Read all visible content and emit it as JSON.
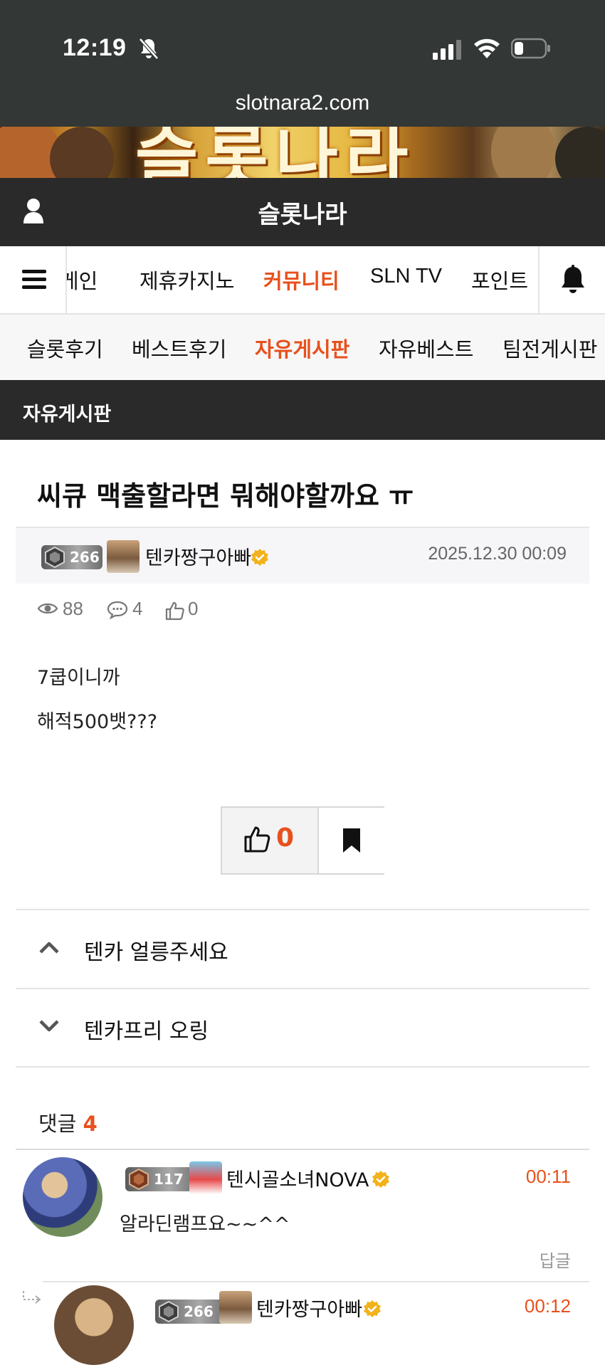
{
  "status_bar": {
    "time": "12:19",
    "url": "slotnara2.com"
  },
  "banner": {
    "text": "슬롯나라"
  },
  "header": {
    "title": "슬롯나라"
  },
  "main_nav": {
    "items": [
      {
        "label": "게인",
        "active": false
      },
      {
        "label": "제휴카지노",
        "active": false
      },
      {
        "label": "커뮤니티",
        "active": true
      },
      {
        "label": "SLN TV",
        "active": false
      },
      {
        "label": "포인트",
        "active": false
      }
    ]
  },
  "sub_nav": {
    "items": [
      {
        "label": "슬롯후기",
        "active": false
      },
      {
        "label": "베스트후기",
        "active": false
      },
      {
        "label": "자유게시판",
        "active": true
      },
      {
        "label": "자유베스트",
        "active": false
      },
      {
        "label": "팀전게시판",
        "active": false
      }
    ]
  },
  "section": {
    "title": "자유게시판"
  },
  "post": {
    "title": "씨큐 맥출할라면 뭐해야할까요 ㅠ",
    "author": {
      "name": "텐카짱구아빠",
      "level": "266"
    },
    "date": "2025.12.30 00:09",
    "views": "88",
    "comments": "4",
    "likes": "0",
    "body": [
      "7쿱이니까",
      "해적500뱃???"
    ],
    "like_count": "0"
  },
  "adjacent": {
    "prev": "텐카 얼릉주세요",
    "next": "텐카프리 오링"
  },
  "comments_section": {
    "label": "댓글",
    "count": "4",
    "items": [
      {
        "level": "117",
        "name": "텐시골소녀NOVA",
        "time": "00:11",
        "text": "알라딘램프요~~^^",
        "reply": "답글"
      },
      {
        "level": "266",
        "name": "텐카짱구아빠",
        "time": "00:12"
      }
    ]
  },
  "colors": {
    "accent": "#e8501c",
    "header_bg": "#2a2a2a",
    "status_bg": "#333735"
  }
}
